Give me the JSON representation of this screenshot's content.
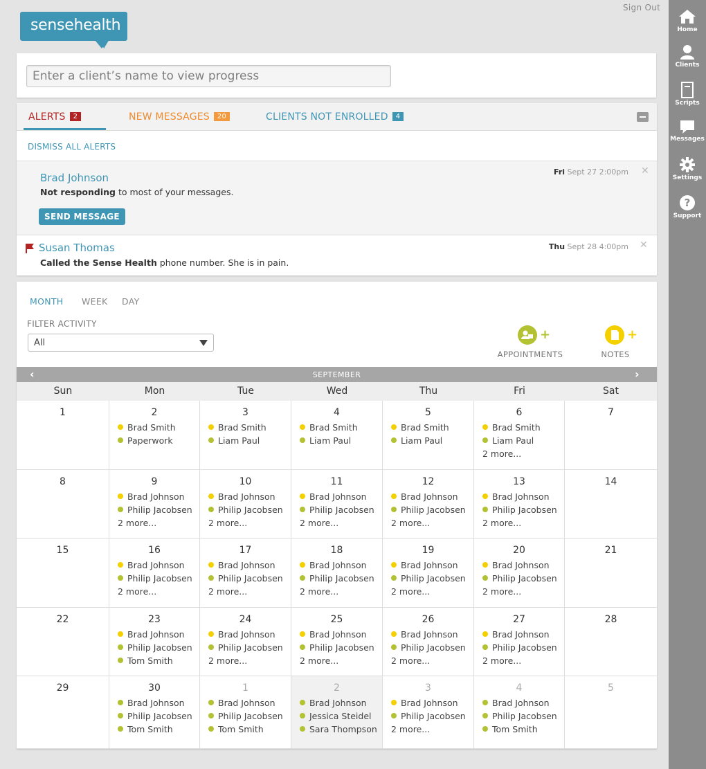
{
  "colors": {
    "brand": "#3f96b4",
    "alert": "#b32323",
    "messages": "#f29a3d",
    "dot_yellow": "#f5d000",
    "dot_olive": "#b3c232"
  },
  "header": {
    "sign_out": "Sign Out",
    "logo": "sensehealth"
  },
  "nav": {
    "items": [
      {
        "label": "Home",
        "icon": "home-icon"
      },
      {
        "label": "Clients",
        "icon": "person-icon"
      },
      {
        "label": "Scripts",
        "icon": "script-icon"
      },
      {
        "label": "Messages",
        "icon": "chat-icon"
      },
      {
        "label": "Settings",
        "icon": "gear-icon"
      },
      {
        "label": "Support",
        "icon": "help-icon"
      }
    ]
  },
  "search": {
    "placeholder": "Enter a client’s name to view progress"
  },
  "alerts": {
    "tabs": [
      {
        "label": "ALERTS",
        "count": "2"
      },
      {
        "label": "NEW MESSAGES",
        "count": "20"
      },
      {
        "label": "CLIENTS NOT ENROLLED",
        "count": "4"
      }
    ],
    "dismiss_all": "DISMISS ALL ALERTS",
    "items": [
      {
        "name": "Brad Johnson",
        "text_bold": "Not responding",
        "text_rest": " to most of your messages.",
        "date_day": "Fri",
        "date_rest": " Sept 27 2:00pm",
        "button": "SEND MESSAGE",
        "close": "✕"
      },
      {
        "name": "Susan Thomas",
        "text_bold": "Called the Sense Health",
        "text_rest": " phone number. She is in pain.",
        "date_day": "Thu",
        "date_rest": " Sept 28 4:00pm",
        "close": "✕"
      }
    ]
  },
  "calendar": {
    "views": [
      "MONTH",
      "WEEK",
      "DAY"
    ],
    "filter_label": "FILTER ACTIVITY",
    "filter_value": "All",
    "quick_actions": [
      {
        "label": "APPOINTMENTS",
        "plus": "+"
      },
      {
        "label": "NOTES",
        "plus": "+"
      }
    ],
    "month": "SEPTEMBER",
    "prev": "‹",
    "next": "›",
    "weekdays": [
      "Sun",
      "Mon",
      "Tue",
      "Wed",
      "Thu",
      "Fri",
      "Sat"
    ],
    "weeks": [
      [
        {
          "day": "1",
          "events": []
        },
        {
          "day": "2",
          "events": [
            {
              "n": "Brad Smith",
              "c": "y"
            },
            {
              "n": "Paperwork",
              "c": "o"
            }
          ]
        },
        {
          "day": "3",
          "events": [
            {
              "n": "Brad Smith",
              "c": "y"
            },
            {
              "n": "Liam Paul",
              "c": "o"
            }
          ]
        },
        {
          "day": "4",
          "events": [
            {
              "n": "Brad Smith",
              "c": "y"
            },
            {
              "n": "Liam Paul",
              "c": "o"
            }
          ]
        },
        {
          "day": "5",
          "events": [
            {
              "n": "Brad Smith",
              "c": "y"
            },
            {
              "n": "Liam Paul",
              "c": "o"
            }
          ]
        },
        {
          "day": "6",
          "events": [
            {
              "n": "Brad Smith",
              "c": "y"
            },
            {
              "n": "Liam Paul",
              "c": "o"
            }
          ],
          "more": "2 more..."
        },
        {
          "day": "7",
          "events": []
        }
      ],
      [
        {
          "day": "8",
          "events": []
        },
        {
          "day": "9",
          "events": [
            {
              "n": "Brad Johnson",
              "c": "y"
            },
            {
              "n": "Philip Jacobsen",
              "c": "o"
            }
          ],
          "more": "2 more..."
        },
        {
          "day": "10",
          "events": [
            {
              "n": "Brad Johnson",
              "c": "y"
            },
            {
              "n": "Philip Jacobsen",
              "c": "o"
            }
          ],
          "more": "2 more..."
        },
        {
          "day": "11",
          "events": [
            {
              "n": "Brad Johnson",
              "c": "y"
            },
            {
              "n": "Philip Jacobsen",
              "c": "o"
            }
          ],
          "more": "2 more..."
        },
        {
          "day": "12",
          "events": [
            {
              "n": "Brad Johnson",
              "c": "y"
            },
            {
              "n": "Philip Jacobsen",
              "c": "o"
            }
          ],
          "more": "2 more..."
        },
        {
          "day": "13",
          "events": [
            {
              "n": "Brad Johnson",
              "c": "y"
            },
            {
              "n": "Philip Jacobsen",
              "c": "o"
            }
          ],
          "more": "2 more..."
        },
        {
          "day": "14",
          "events": []
        }
      ],
      [
        {
          "day": "15",
          "events": []
        },
        {
          "day": "16",
          "events": [
            {
              "n": "Brad Johnson",
              "c": "y"
            },
            {
              "n": "Philip Jacobsen",
              "c": "o"
            }
          ],
          "more": "2 more..."
        },
        {
          "day": "17",
          "events": [
            {
              "n": "Brad Johnson",
              "c": "y"
            },
            {
              "n": "Philip Jacobsen",
              "c": "o"
            }
          ],
          "more": "2 more..."
        },
        {
          "day": "18",
          "events": [
            {
              "n": "Brad Johnson",
              "c": "y"
            },
            {
              "n": "Philip Jacobsen",
              "c": "o"
            }
          ],
          "more": "2 more..."
        },
        {
          "day": "19",
          "events": [
            {
              "n": "Brad Johnson",
              "c": "y"
            },
            {
              "n": "Philip Jacobsen",
              "c": "o"
            }
          ],
          "more": "2 more..."
        },
        {
          "day": "20",
          "events": [
            {
              "n": "Brad Johnson",
              "c": "y"
            },
            {
              "n": "Philip Jacobsen",
              "c": "o"
            }
          ],
          "more": "2 more..."
        },
        {
          "day": "21",
          "events": []
        }
      ],
      [
        {
          "day": "22",
          "events": []
        },
        {
          "day": "23",
          "events": [
            {
              "n": "Brad Johnson",
              "c": "y"
            },
            {
              "n": "Philip Jacobsen",
              "c": "o"
            },
            {
              "n": "Tom Smith",
              "c": "o"
            }
          ]
        },
        {
          "day": "24",
          "events": [
            {
              "n": "Brad Johnson",
              "c": "y"
            },
            {
              "n": "Philip Jacobsen",
              "c": "o"
            }
          ],
          "more": "2 more..."
        },
        {
          "day": "25",
          "events": [
            {
              "n": "Brad Johnson",
              "c": "y"
            },
            {
              "n": "Philip Jacobsen",
              "c": "o"
            }
          ],
          "more": "2 more..."
        },
        {
          "day": "26",
          "events": [
            {
              "n": "Brad Johnson",
              "c": "y"
            },
            {
              "n": "Philip Jacobsen",
              "c": "o"
            }
          ],
          "more": "2 more..."
        },
        {
          "day": "27",
          "events": [
            {
              "n": "Brad Johnson",
              "c": "y"
            },
            {
              "n": "Philip Jacobsen",
              "c": "o"
            }
          ],
          "more": "2 more..."
        },
        {
          "day": "28",
          "events": []
        }
      ],
      [
        {
          "day": "29",
          "events": []
        },
        {
          "day": "30",
          "events": [
            {
              "n": "Brad Johnson",
              "c": "o"
            },
            {
              "n": "Philip Jacobsen",
              "c": "o"
            },
            {
              "n": "Tom Smith",
              "c": "o"
            }
          ]
        },
        {
          "day": "1",
          "other": true,
          "events": [
            {
              "n": "Brad Johnson",
              "c": "o"
            },
            {
              "n": "Philip Jacobsen",
              "c": "o"
            },
            {
              "n": "Tom Smith",
              "c": "o"
            }
          ]
        },
        {
          "day": "2",
          "other": true,
          "today": true,
          "events": [
            {
              "n": "Brad Johnson",
              "c": "o"
            },
            {
              "n": "Jessica Steidel",
              "c": "o"
            },
            {
              "n": "Sara Thompson",
              "c": "o"
            }
          ]
        },
        {
          "day": "3",
          "other": true,
          "events": [
            {
              "n": "Brad Johnson",
              "c": "y"
            },
            {
              "n": "Philip Jacobsen",
              "c": "o"
            }
          ],
          "more": "2 more..."
        },
        {
          "day": "4",
          "other": true,
          "events": [
            {
              "n": "Brad Johnson",
              "c": "o"
            },
            {
              "n": "Philip Jacobsen",
              "c": "o"
            },
            {
              "n": "Tom Smith",
              "c": "o"
            }
          ]
        },
        {
          "day": "5",
          "other": true,
          "events": []
        }
      ]
    ]
  }
}
